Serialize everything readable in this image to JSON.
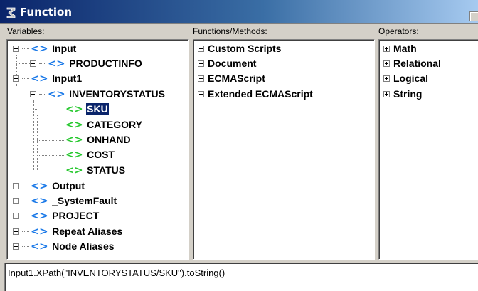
{
  "window": {
    "title": "Function"
  },
  "variables_pane": {
    "label": "Variables:",
    "nodes": [
      {
        "label": "Input",
        "expander": "minus"
      },
      {
        "label": "PRODUCTINFO",
        "expander": "plus"
      },
      {
        "label": "Input1",
        "expander": "minus"
      },
      {
        "label": "INVENTORYSTATUS",
        "expander": "minus"
      },
      {
        "label": "SKU",
        "selected": true
      },
      {
        "label": "CATEGORY"
      },
      {
        "label": "ONHAND"
      },
      {
        "label": "COST"
      },
      {
        "label": "STATUS"
      },
      {
        "label": "Output",
        "expander": "plus"
      },
      {
        "label": "_SystemFault",
        "expander": "plus"
      },
      {
        "label": "PROJECT",
        "expander": "plus"
      },
      {
        "label": "Repeat Aliases",
        "expander": "plus"
      },
      {
        "label": "Node Aliases",
        "expander": "plus"
      }
    ]
  },
  "functions_pane": {
    "label": "Functions/Methods:",
    "items": [
      "Custom Scripts",
      "Document",
      "ECMAScript",
      "Extended ECMAScript"
    ]
  },
  "operators_pane": {
    "label": "Operators:",
    "items": [
      "Math",
      "Relational",
      "Logical",
      "String"
    ]
  },
  "expression": {
    "value": "Input1.XPath(\"INVENTORYSTATUS/SKU\").toString()"
  },
  "icons": {
    "window": "function-icon",
    "node": "xml-element-icon",
    "expander": "tree-expander-icon"
  },
  "colors": {
    "title_bar": "#0a246a",
    "node_tag_blue": "#1c7ae8",
    "node_tag_green": "#28c830",
    "selection": "#0a246a"
  }
}
